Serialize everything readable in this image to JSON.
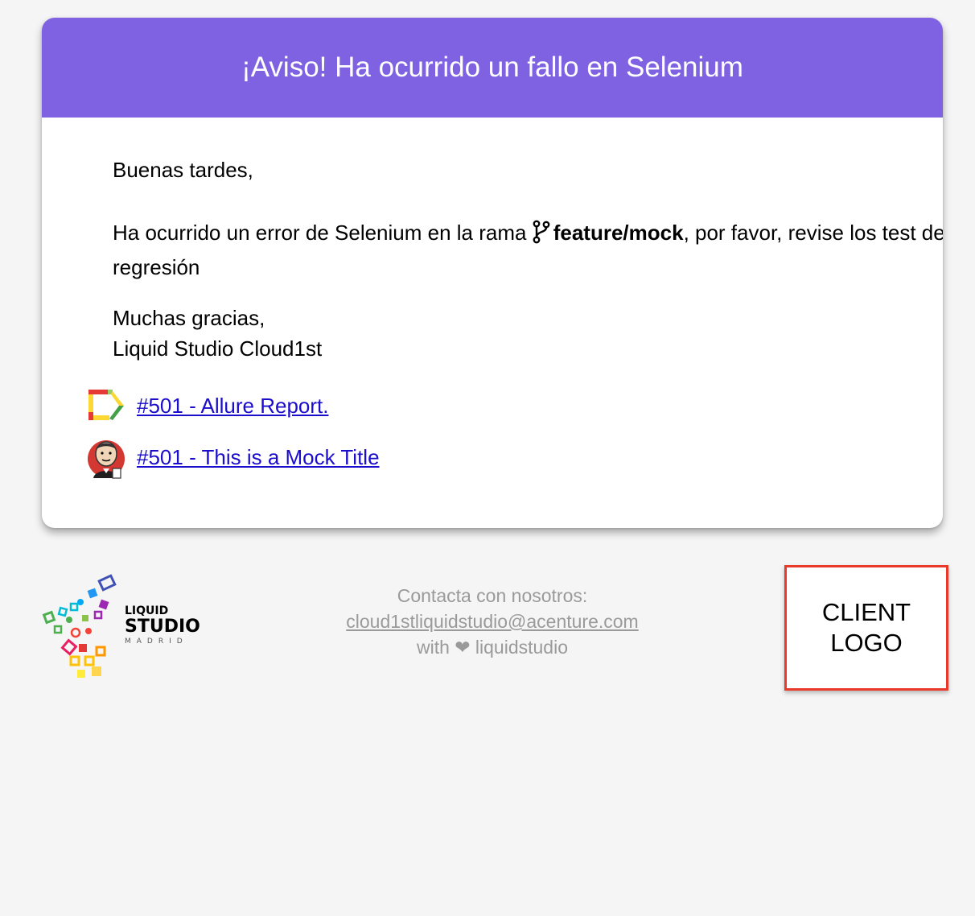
{
  "header": {
    "title": "¡Aviso! Ha ocurrido un fallo en Selenium",
    "color": "#7e62e1"
  },
  "body": {
    "greeting": "Buenas tardes,",
    "message_prefix": "Ha ocurrido un error de Selenium en la rama",
    "branch_icon": "git-branch-icon",
    "branch": "feature/mock",
    "message_suffix": ", por favor, revise los test de regresión",
    "signoff_line1": "Muchas gracias,",
    "signoff_line2": "Liquid Studio Cloud1st"
  },
  "links": [
    {
      "icon": "allure-report-icon",
      "label": "#501 - Allure Report."
    },
    {
      "icon": "jenkins-icon",
      "label": "#501 - This is a Mock Title"
    }
  ],
  "footer": {
    "logo_line1": "LIQUID",
    "logo_line2": "STUDIO",
    "logo_line3": "MADRID",
    "contact_label": "Contacta con nosotros:",
    "contact_email": "cloud1stliquidstudio@acenture.com",
    "signature": "with ❤ liquidstudio",
    "client_logo_line1": "CLIENT",
    "client_logo_line2": "LOGO",
    "client_logo_border": "#e8392a"
  }
}
